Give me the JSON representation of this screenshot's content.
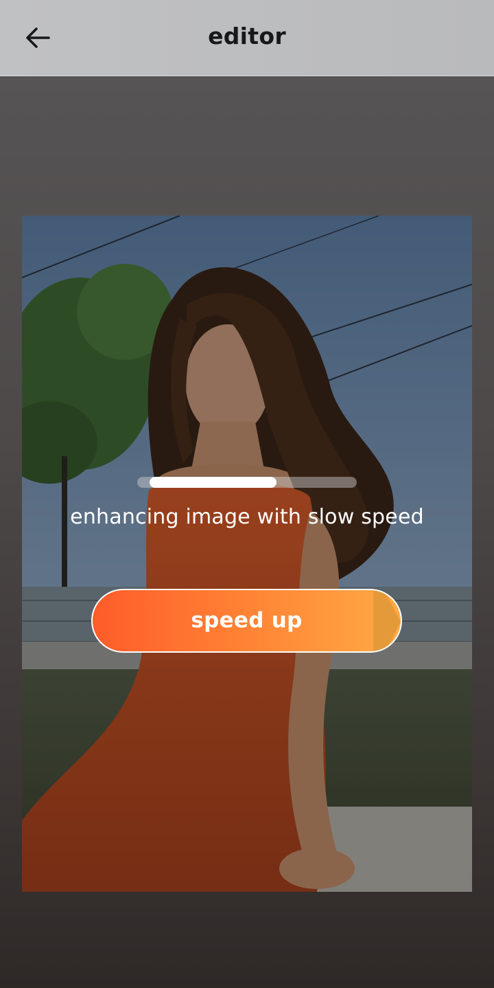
{
  "header": {
    "title": "editor",
    "back_icon": "arrow-left-icon"
  },
  "preview": {
    "status_text": "enhancing image with slow speed",
    "progress": 0.65
  },
  "speed_up": {
    "label": "speed up"
  },
  "colors": {
    "button_start": "#ff5c2a",
    "button_end": "#ffab45",
    "title": "#16191a"
  }
}
